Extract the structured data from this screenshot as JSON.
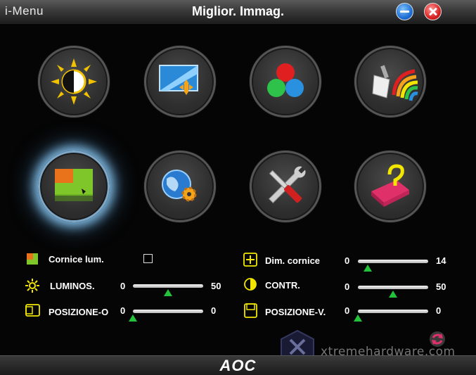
{
  "titlebar": {
    "app_name": "i-Menu",
    "title": "Miglior. Immag."
  },
  "modes": [
    {
      "icon": "brightness-contrast-icon"
    },
    {
      "icon": "image-setup-icon"
    },
    {
      "icon": "color-setup-icon"
    },
    {
      "icon": "picture-boost-icon"
    },
    {
      "icon": "bright-frame-icon"
    },
    {
      "icon": "osd-setup-globe-icon"
    },
    {
      "icon": "extra-tools-icon"
    },
    {
      "icon": "exit-factory-icon"
    }
  ],
  "settings": {
    "frame": {
      "label": "Cornice lum."
    },
    "brightness": {
      "label": "LUMINOS.",
      "min": "0",
      "max": "50",
      "value": 25
    },
    "hpos": {
      "label": "POSIZIONE-O",
      "min": "0",
      "max": "0",
      "value": 0
    },
    "frame_size": {
      "label": "Dim. cornice",
      "min": "0",
      "max": "14",
      "value": 2
    },
    "contrast": {
      "label": "CONTR.",
      "min": "0",
      "max": "50",
      "value": 25
    },
    "vpos": {
      "label": "POSIZIONE-V.",
      "min": "0",
      "max": "0",
      "value": 0
    }
  },
  "footer": {
    "brand": "AOC",
    "watermark": "xtremehardware.com"
  },
  "colors": {
    "accent_green": "#22c23a",
    "selected_glow": "#8cc8f0"
  }
}
